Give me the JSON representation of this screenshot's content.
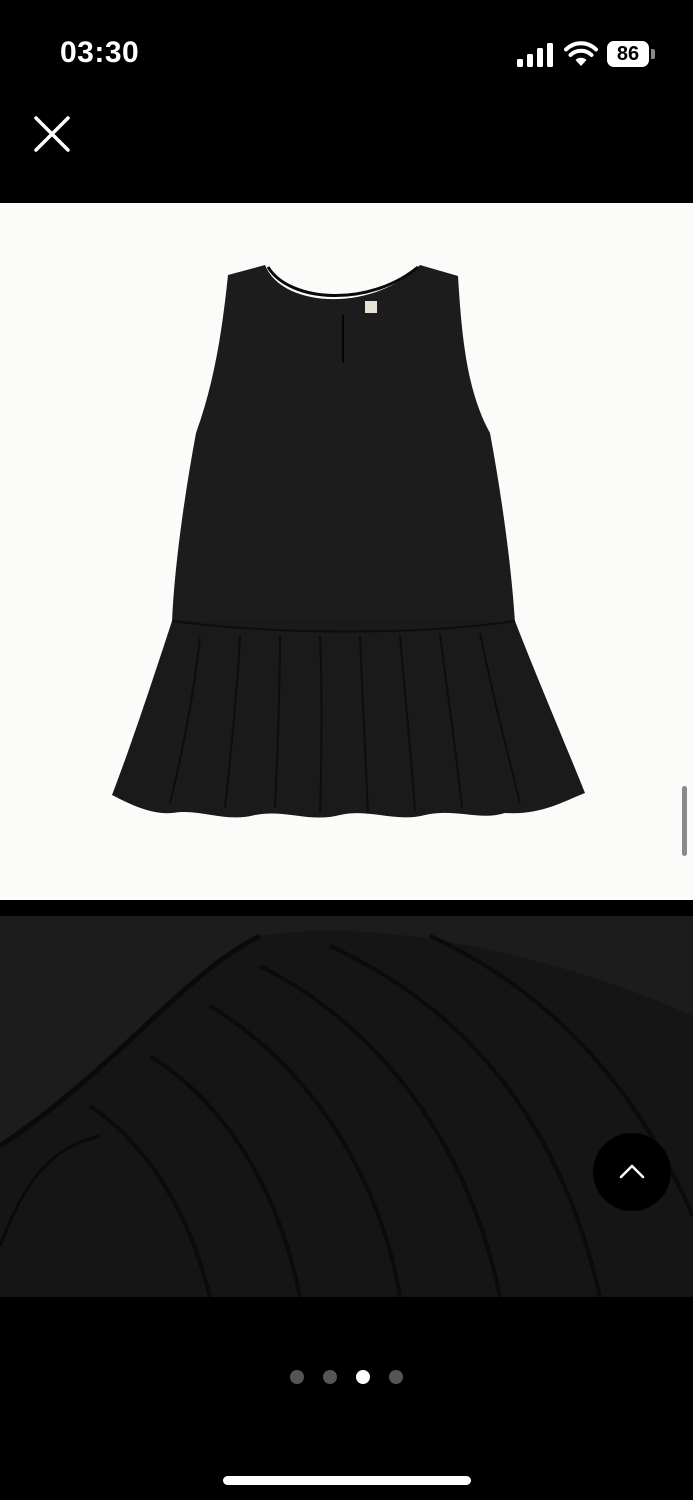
{
  "status_bar": {
    "time": "03:30",
    "battery": "86",
    "icons": [
      "signal-icon",
      "wifi-icon",
      "battery-icon"
    ]
  },
  "viewer": {
    "close_icon": "close-icon",
    "scroll_top_icon": "chevron-up-icon",
    "pagination": {
      "total": 4,
      "active_index": 2
    }
  },
  "colors": {
    "background": "#000000",
    "photo_background": "#fbfbfa",
    "garment": "#1c1c1c",
    "dot_inactive": "#555555",
    "dot_active": "#ffffff"
  }
}
